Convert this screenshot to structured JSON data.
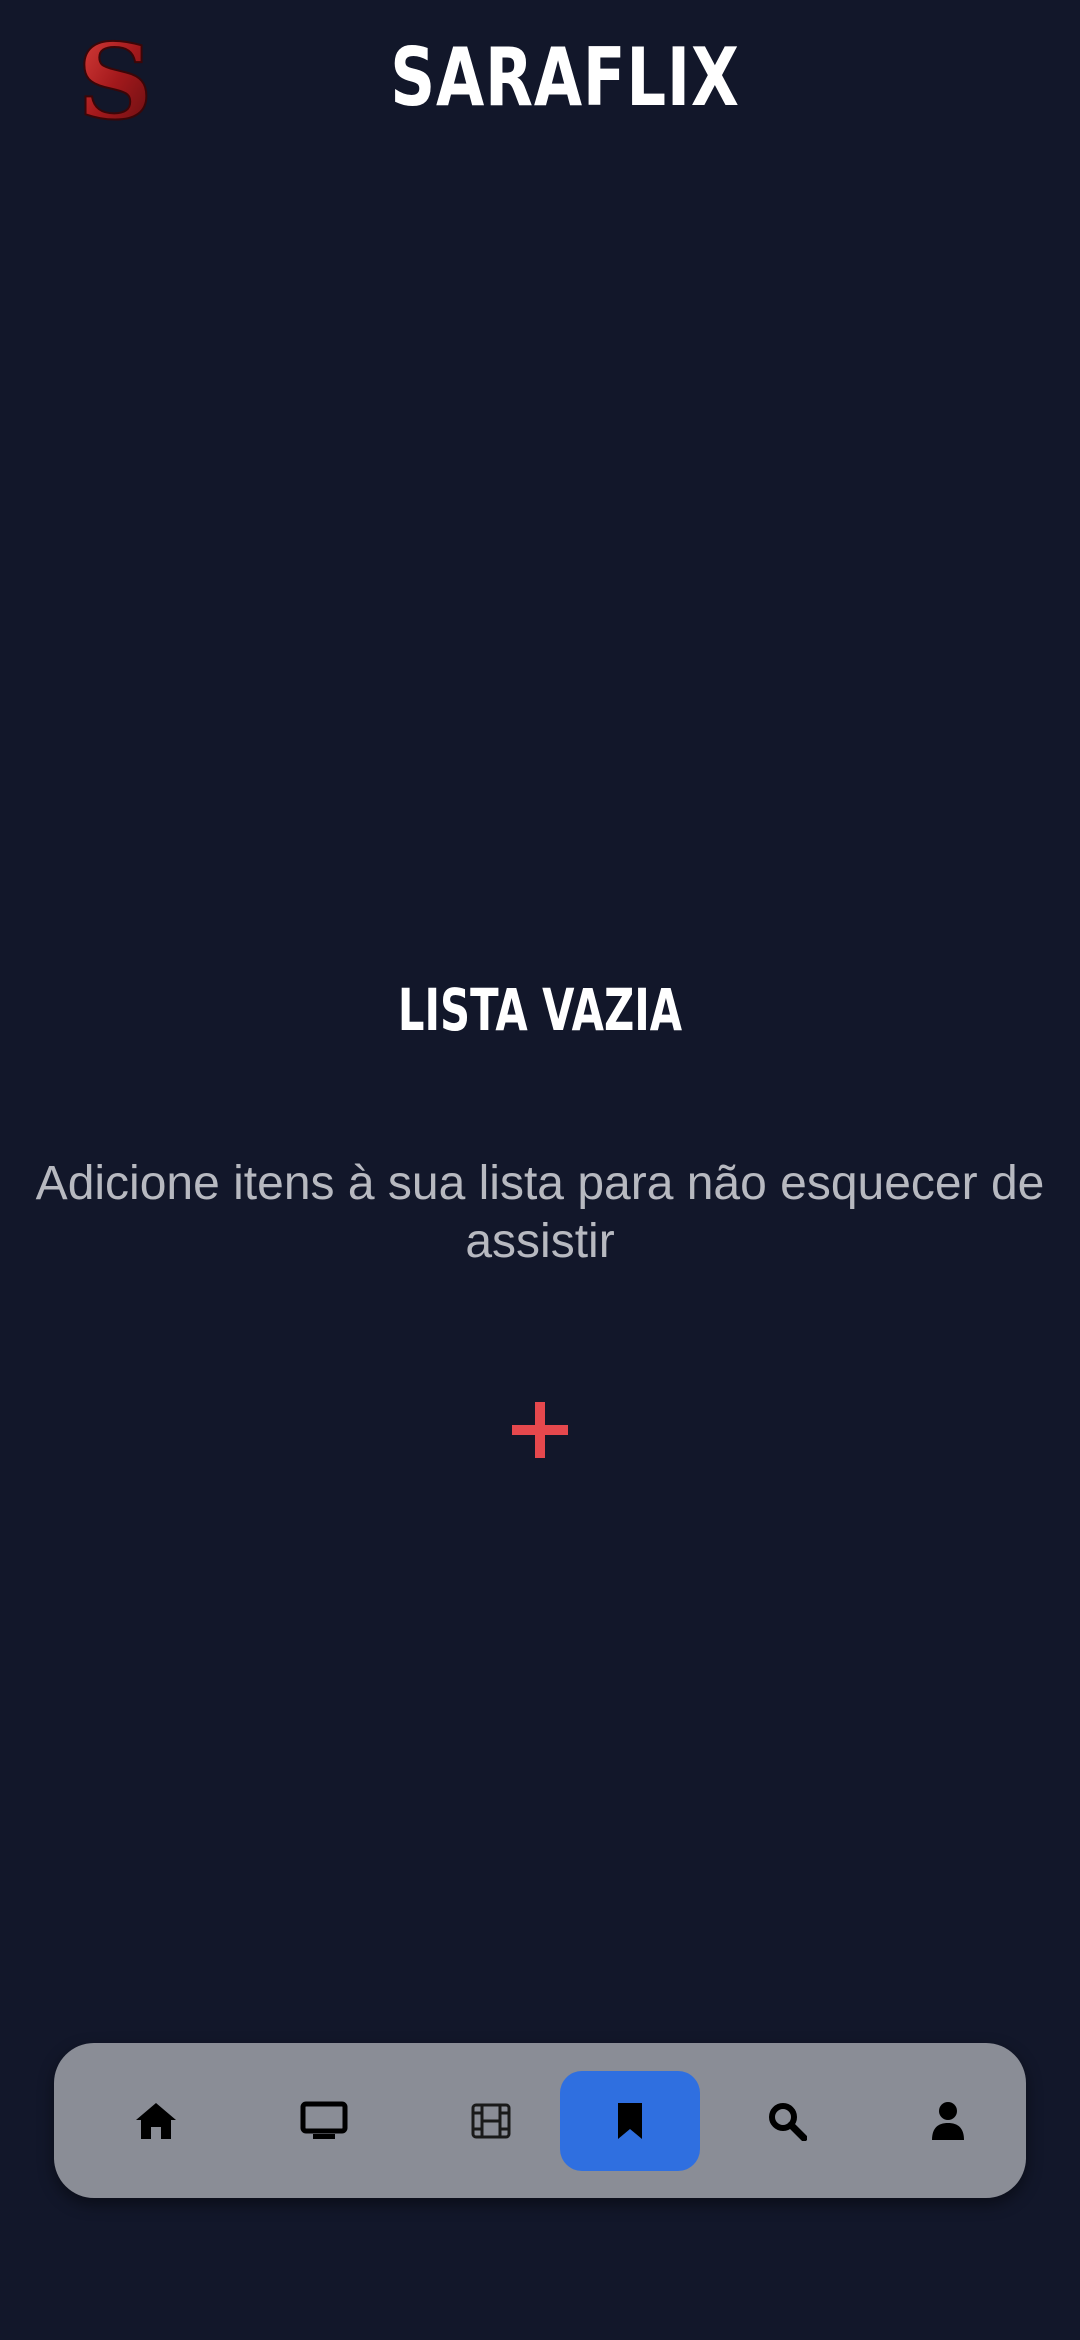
{
  "header": {
    "logo_letter": "S",
    "title": "SARAFLIX"
  },
  "empty_state": {
    "title": "LISTA VAZIA",
    "message": "Adicione itens à sua lista para não esquecer de assistir",
    "add_icon": "plus-icon"
  },
  "colors": {
    "background": "#12172a",
    "accent_red": "#e5484d",
    "nav_background": "#8a8d96",
    "nav_active": "#2f6fe0"
  },
  "bottom_nav": {
    "items": [
      {
        "icon": "home-icon",
        "active": false
      },
      {
        "icon": "tv-icon",
        "active": false
      },
      {
        "icon": "film-icon",
        "active": false
      },
      {
        "icon": "bookmark-icon",
        "active": true
      },
      {
        "icon": "search-icon",
        "active": false
      },
      {
        "icon": "user-icon",
        "active": false
      }
    ]
  }
}
